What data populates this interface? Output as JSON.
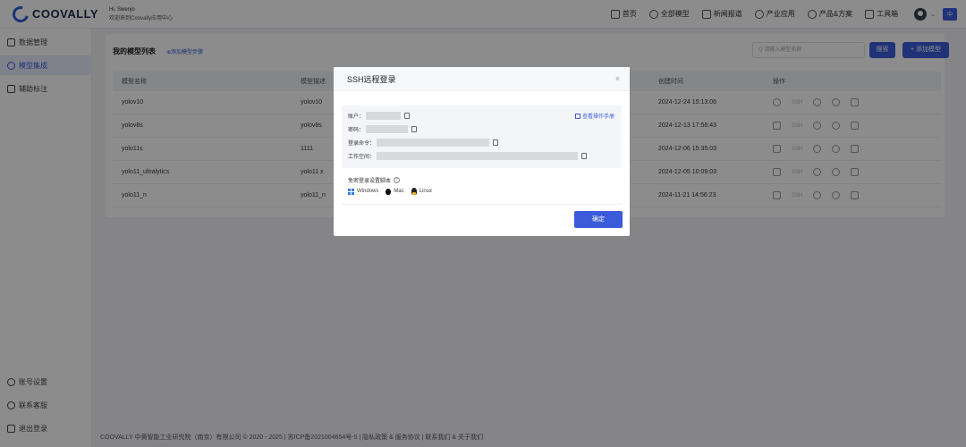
{
  "header": {
    "logo_text": "COOVALLY",
    "greeting": "Hi, Swenjo",
    "welcome": "欢迎来到Coovally应用中心",
    "nav": [
      {
        "label": "首页",
        "icon": "home-icon"
      },
      {
        "label": "全部模型",
        "icon": "model-icon"
      },
      {
        "label": "新闻报道",
        "icon": "news-icon"
      },
      {
        "label": "产业应用",
        "icon": "industry-icon"
      },
      {
        "label": "产品&方案",
        "icon": "product-icon"
      },
      {
        "label": "工具箱",
        "icon": "toolbox-icon"
      }
    ],
    "lang_badge": "中"
  },
  "sidebar": {
    "items": [
      {
        "label": "数据管理",
        "icon": "data-icon",
        "active": false
      },
      {
        "label": "模型集成",
        "icon": "model-integration-icon",
        "active": true
      },
      {
        "label": "辅助标注",
        "icon": "annotation-icon",
        "active": false
      }
    ],
    "bottom": [
      {
        "label": "账号设置",
        "icon": "user-icon"
      },
      {
        "label": "联系客服",
        "icon": "support-icon"
      },
      {
        "label": "退出登录",
        "icon": "logout-icon"
      }
    ]
  },
  "main": {
    "title": "我的模型列表",
    "add_link": "⊕添加模型步骤",
    "search_placeholder": "Q 请输入模型名称",
    "search_button": "搜索",
    "add_button": "+ 添加模型",
    "columns": [
      "模型名称",
      "模型描述",
      "",
      "创建时间",
      "操作"
    ],
    "rows": [
      {
        "name": "yolov10",
        "desc": "yolov10",
        "time": "2024-12-24 15:13:06"
      },
      {
        "name": "yolov8s",
        "desc": "yolov8s",
        "time": "2024-12-13 17:56:43"
      },
      {
        "name": "yolo11s",
        "desc": "1111",
        "time": "2024-12-06 15:35:03"
      },
      {
        "name": "yolo11_ultralytics",
        "desc": "yolo11 x",
        "time": "2024-12-05 10:09:03"
      },
      {
        "name": "yolo11_n",
        "desc": "yolo11_n",
        "time": "2024-11-21 14:56:23"
      }
    ],
    "op_ssh": "SSH"
  },
  "footer": "COOVALLY 中黄智能工业研究院（南京）有限公司 © 2020 - 2025 | 苏ICP备2021004654号-5 | 隐私政策 & 服务协议 | 联系我们 & 关于我们",
  "modal": {
    "title": "SSH远程登录",
    "close": "×",
    "account_label": "账户：",
    "password_label": "密码：",
    "login_cmd_label": "登录命令：",
    "workspace_label": "工作空间：",
    "manual_link": "查看操作手册",
    "script_title": "免密登录设置脚本",
    "os": [
      "Windows",
      "Mac",
      "Linux"
    ],
    "ok": "确定"
  },
  "colors": {
    "accent": "#3b5bdb",
    "overlay": "rgba(0,0,0,0.45)"
  }
}
